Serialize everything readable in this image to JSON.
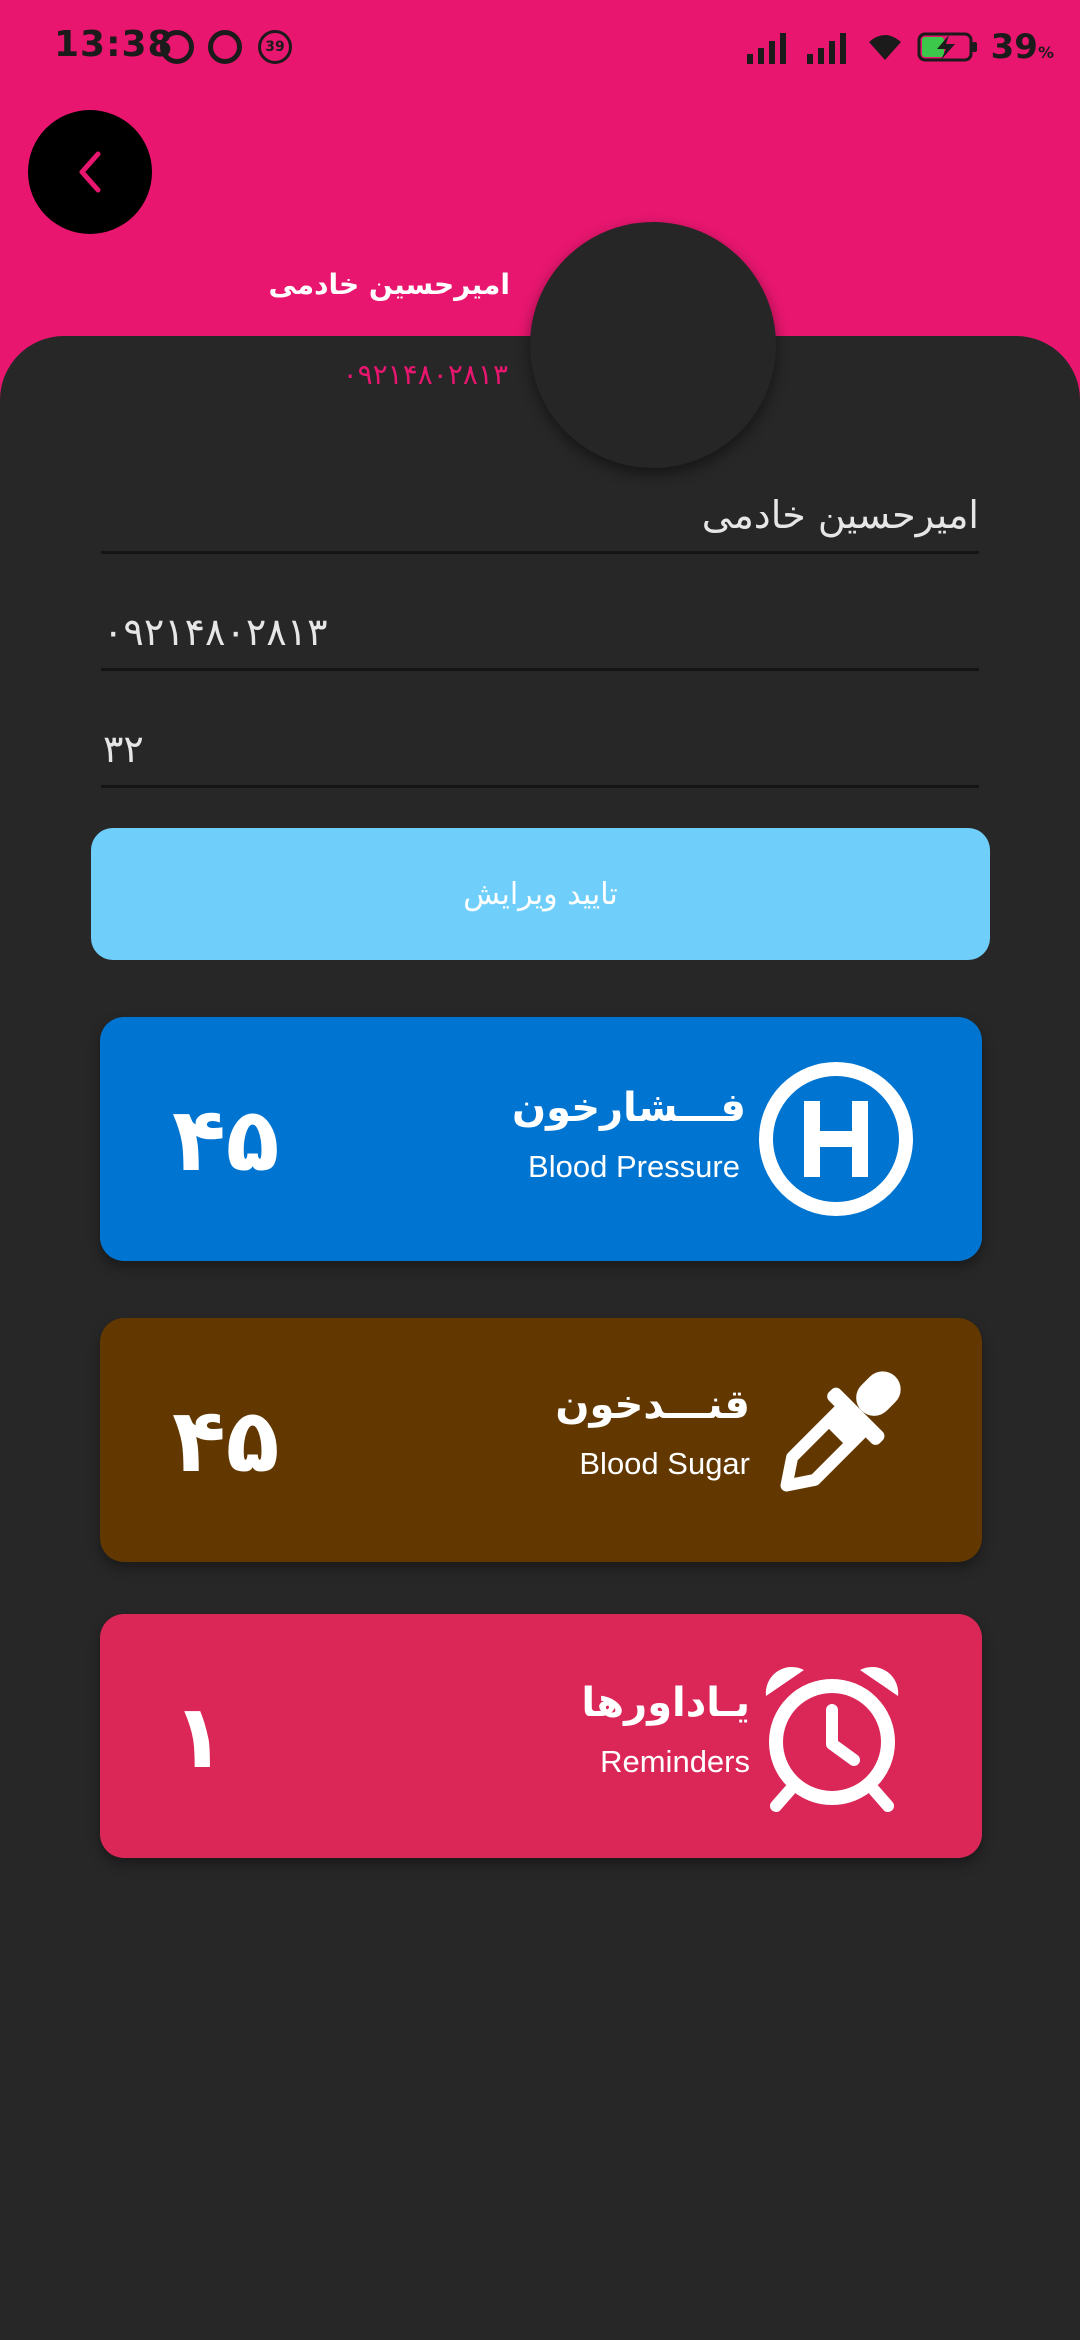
{
  "status_bar": {
    "time": "13:38",
    "badge_number": "39",
    "battery_percent": "39",
    "battery_symbol": "%"
  },
  "profile": {
    "name": "امیرحسین خادمی",
    "phone": "۰۹۲۱۴۸۰۲۸۱۳"
  },
  "form": {
    "name_value": "امیرحسین خادمی",
    "phone_value": "۰۹۲۱۴۸۰۲۸۱۳",
    "age_value": "۳۲",
    "confirm_label": "تایید ویرایش"
  },
  "cards": [
    {
      "title": "فـــشارخون",
      "subtitle": "Blood Pressure",
      "value": "۴۵",
      "icon": "hospital-h-icon",
      "color": "#0074d1"
    },
    {
      "title": "قنـــدخون",
      "subtitle": "Blood Sugar",
      "value": "۴۵",
      "icon": "dropper-icon",
      "color": "#623800"
    },
    {
      "title": "یـاداورها",
      "subtitle": "Reminders",
      "value": "۱",
      "icon": "alarm-clock-icon",
      "color": "#db2758"
    }
  ],
  "colors": {
    "header": "#e8166f",
    "background": "#272727",
    "confirm_button": "#70cffa"
  }
}
